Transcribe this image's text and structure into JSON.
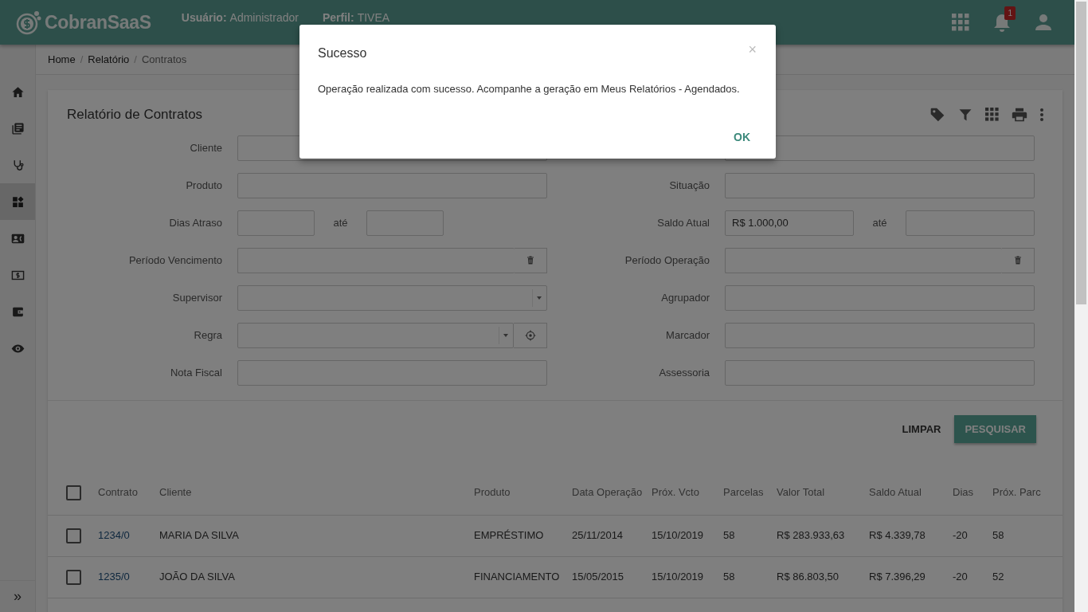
{
  "header": {
    "brand": "CobranSaaS",
    "user_label": "Usuário:",
    "user_value": "Administrador",
    "profile_label": "Perfil:",
    "profile_value": "TIVEA",
    "notification_count": "1"
  },
  "sidebar": {
    "items": [
      {
        "selected": false
      },
      {
        "selected": false
      },
      {
        "selected": false
      },
      {
        "selected": true
      },
      {
        "selected": false
      },
      {
        "selected": false
      },
      {
        "selected": false
      },
      {
        "selected": false
      }
    ],
    "expand": "»"
  },
  "breadcrumb": {
    "items": [
      "Home",
      "Relatório",
      "Contratos"
    ],
    "separators": [
      "/",
      "/"
    ]
  },
  "card": {
    "title": "Relatório de Contratos",
    "left_fields": [
      {
        "kind": "text",
        "label": "Cliente"
      },
      {
        "kind": "text",
        "label": "Produto"
      },
      {
        "kind": "range",
        "label": "Dias Atraso",
        "between": "até"
      },
      {
        "kind": "date",
        "label": "Período Vencimento"
      },
      {
        "kind": "select",
        "label": "Supervisor"
      },
      {
        "kind": "select-action",
        "label": "Regra"
      },
      {
        "kind": "text",
        "label": "Nota Fiscal"
      }
    ],
    "right_fields": [
      {
        "kind": "text"
      },
      {
        "kind": "text",
        "label": "Situação"
      },
      {
        "kind": "range",
        "label": "Saldo Atual",
        "value": "R$ 1.000,00",
        "between": "até"
      },
      {
        "kind": "date",
        "label": "Período Operação"
      },
      {
        "kind": "text",
        "label": "Agrupador"
      },
      {
        "kind": "text",
        "label": "Marcador"
      },
      {
        "kind": "text",
        "label": "Assessoria"
      }
    ],
    "buttons": [
      {
        "label": "LIMPAR",
        "kind": "flat"
      },
      {
        "label": "PESQUISAR",
        "kind": "raised"
      }
    ]
  },
  "table": {
    "header_checked": false,
    "columns": [
      "Contrato",
      "Cliente",
      "Produto",
      "Data Operação",
      "Próx. Vcto",
      "Parcelas",
      "Valor Total",
      "Saldo Atual",
      "Dias",
      "Próx. Parc"
    ],
    "rows": [
      {
        "checked": false,
        "cells": [
          "1234/0",
          "MARIA DA SILVA",
          "EMPRÉSTIMO",
          "25/11/2014",
          "15/10/2019",
          "58",
          "R$ 283.933,63",
          "R$ 4.339,78",
          "-20",
          "58"
        ]
      },
      {
        "checked": false,
        "cells": [
          "1235/0",
          "JOÃO DA SILVA",
          "FINANCIAMENTO",
          "15/05/2015",
          "15/10/2019",
          "58",
          "R$ 86.803,50",
          "R$ 7.396,29",
          "-20",
          "52"
        ]
      }
    ]
  },
  "modal": {
    "title": "Sucesso",
    "close": "×",
    "message": "Operação realizada com sucesso. Acompanhe a geração em Meus Relatórios - Agendados.",
    "button": "OK"
  }
}
